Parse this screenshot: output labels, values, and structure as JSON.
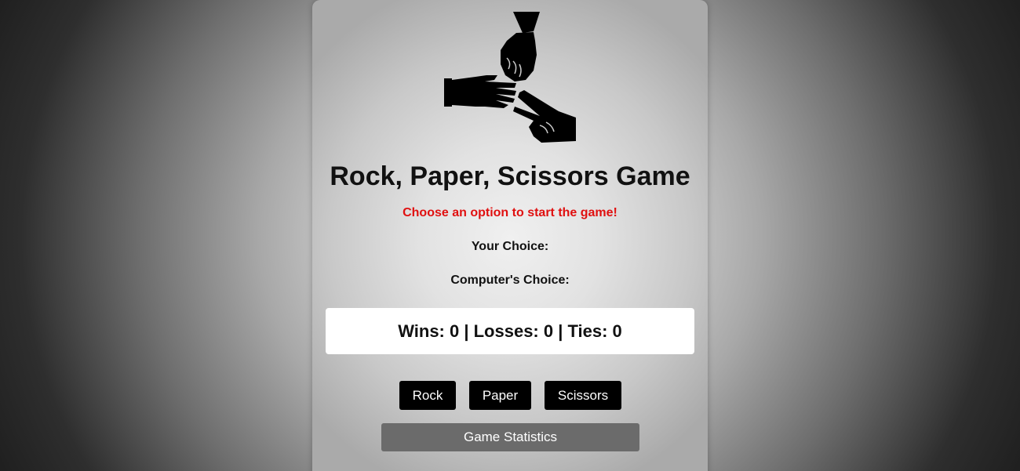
{
  "game": {
    "title": "Rock, Paper, Scissors Game",
    "message": "Choose an option to start the game!",
    "your_choice_label": "Your Choice:",
    "computer_choice_label": "Computer's Choice:",
    "score_text": "Wins: 0 | Losses: 0 | Ties: 0",
    "logo_icon": "rock-paper-scissors-hands-icon"
  },
  "buttons": {
    "rock": "Rock",
    "paper": "Paper",
    "scissors": "Scissors",
    "statistics": "Game Statistics"
  },
  "colors": {
    "message": "#e01010",
    "button_bg": "#000000",
    "stats_button_bg": "#6b6b6b",
    "score_box_bg": "#ffffff"
  }
}
